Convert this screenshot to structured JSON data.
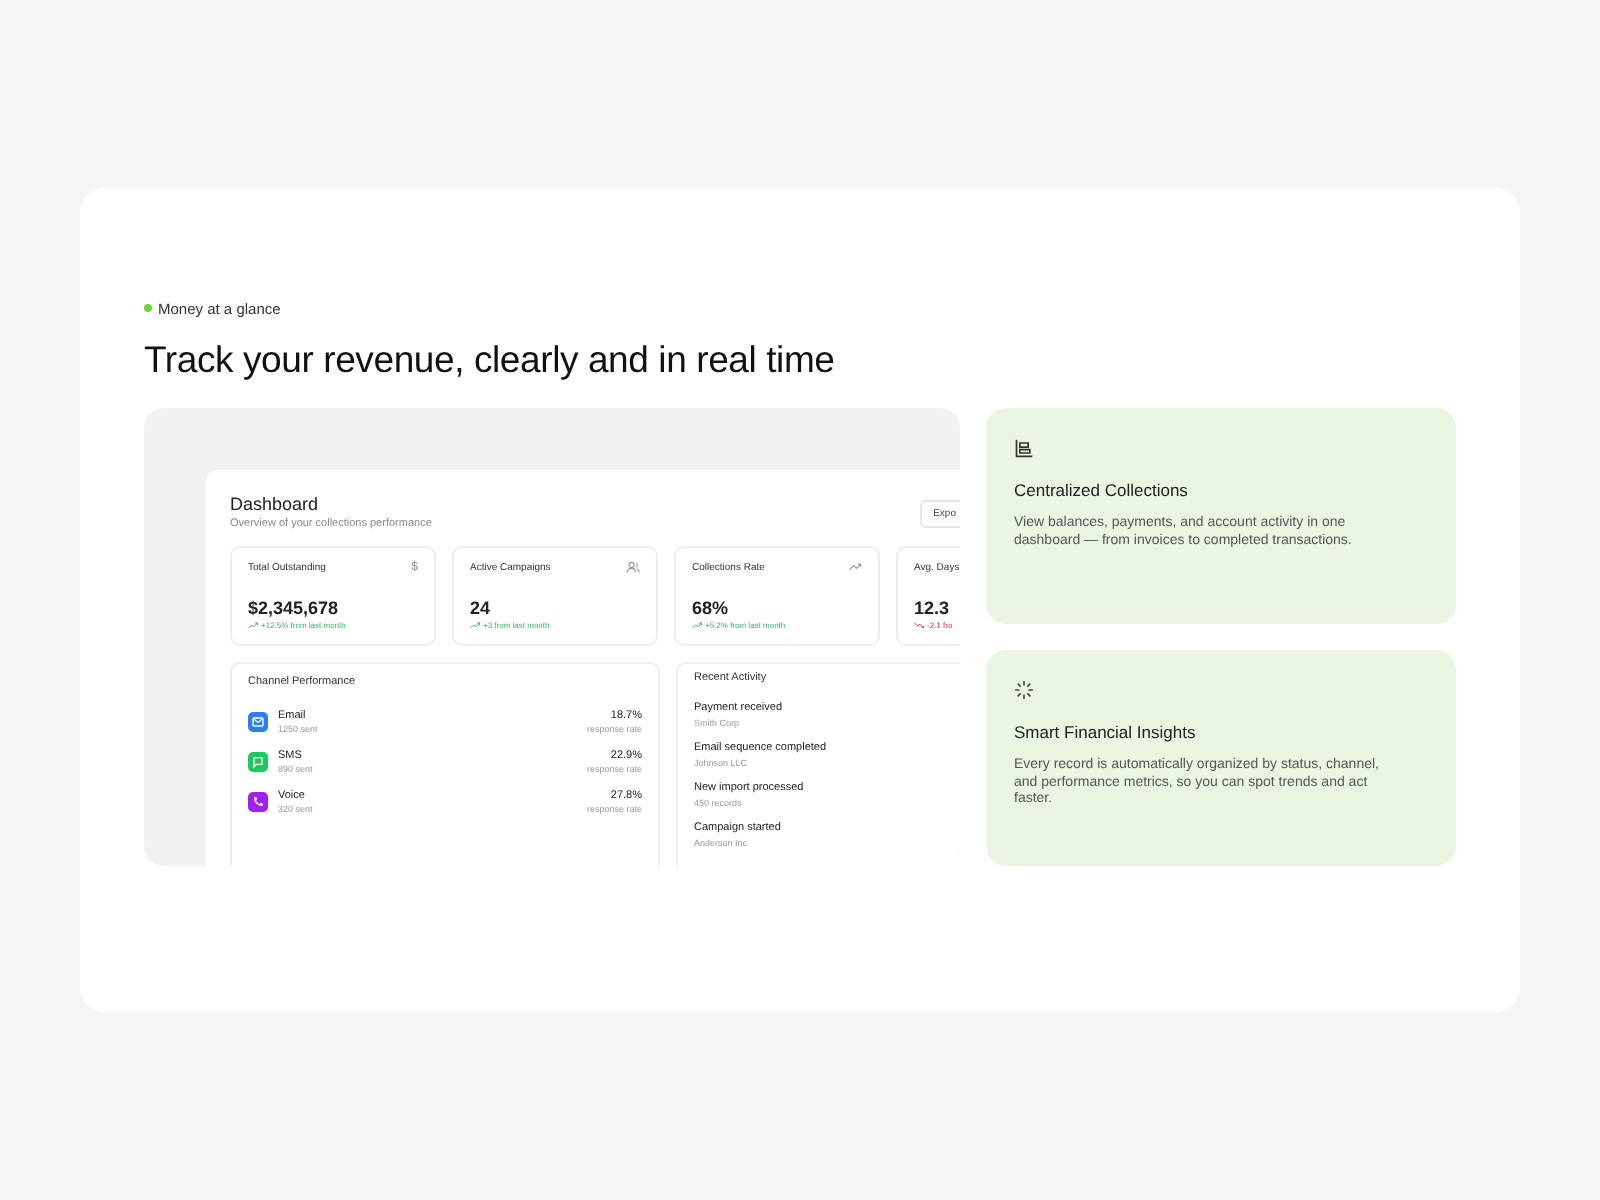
{
  "eyebrow": {
    "text": "Money at a glance"
  },
  "heading": "Track your revenue, clearly and in real time",
  "dashboard": {
    "title": "Dashboard",
    "subtitle": "Overview of your collections performance",
    "export_button": "Expo",
    "stat_cards": [
      {
        "kind": "symbol",
        "title": "Total Outstanding",
        "symbol": "$",
        "value": "$2,345,678",
        "change": {
          "kind": "up",
          "text": "+12.5% from last month"
        }
      },
      {
        "kind": "users",
        "title": "Active Campaigns",
        "value": "24",
        "change": {
          "kind": "up",
          "text": "+3 from last month"
        }
      },
      {
        "kind": "trend",
        "title": "Collections Rate",
        "value": "68%",
        "change": {
          "kind": "up",
          "text": "+5.2% from last month"
        }
      },
      {
        "kind": "plain",
        "title": "Avg. Days",
        "value": "12.3",
        "change": {
          "kind": "down",
          "text": "-2.1 fro"
        }
      }
    ],
    "channel_panel": {
      "title": "Channel Performance",
      "channels": [
        {
          "kind": "email",
          "name": "Email",
          "sent": "1250 sent",
          "rate": "18.7%",
          "rate_label": "response rate",
          "color": "#2f7cf6"
        },
        {
          "kind": "sms",
          "name": "SMS",
          "sent": "890 sent",
          "rate": "22.9%",
          "rate_label": "response rate",
          "color": "#22c55e"
        },
        {
          "kind": "voice",
          "name": "Voice",
          "sent": "320 sent",
          "rate": "27.8%",
          "rate_label": "response rate",
          "color": "#a020f0"
        }
      ]
    },
    "activity_panel": {
      "title": "Recent Activity",
      "items": [
        {
          "title": "Payment received",
          "subtitle": "Smith Corp"
        },
        {
          "title": "Email sequence completed",
          "subtitle": "Johnson LLC"
        },
        {
          "title": "New import processed",
          "subtitle": "450 records"
        },
        {
          "title": "Campaign started",
          "subtitle": "Anderson Inc"
        }
      ]
    }
  },
  "features": [
    {
      "kind": "list",
      "title": "Centralized Collections",
      "text": "View balances, payments, and account activity in one dashboard — from invoices to completed transactions."
    },
    {
      "kind": "spinner",
      "title": "Smart Financial Insights",
      "text": "Every record is automatically organized by status, channel, and performance metrics, so you can spot trends and act faster."
    }
  ]
}
